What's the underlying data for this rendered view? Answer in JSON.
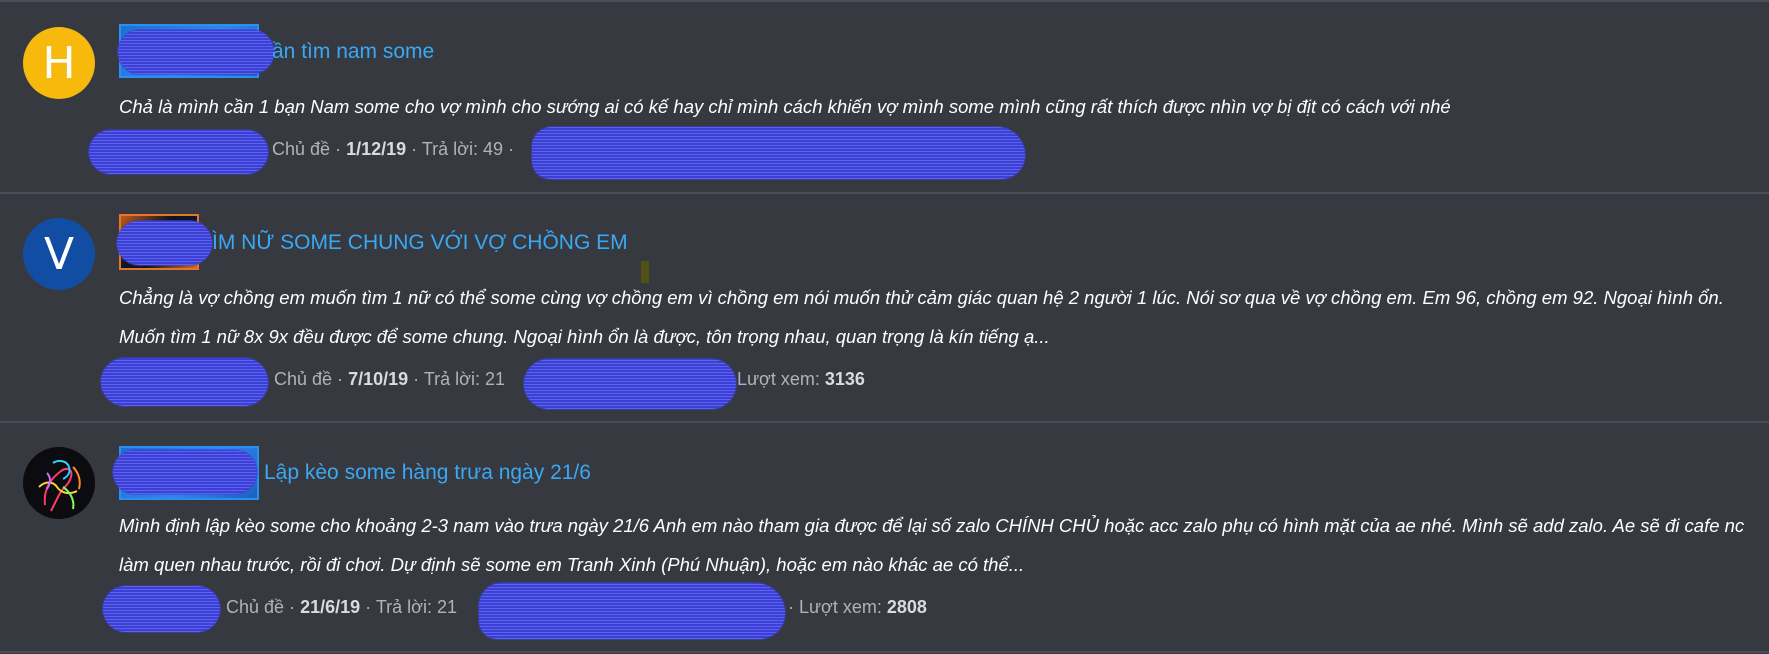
{
  "threads": [
    {
      "avatar_letter": "H",
      "avatar_color": "#f6b90c",
      "title": "ần tìm nam some",
      "snippet": "Chả là mình cần 1 bạn Nam some cho vợ mình cho sướng ai có kế hay chỉ mình cách khiến vợ mình some mình cũng rất thích được nhìn vợ bị địt có cách với nhé",
      "meta": {
        "type_label": "Chủ đề",
        "date": "1/12/19",
        "replies_label": "Trả lời:",
        "replies": "49"
      }
    },
    {
      "avatar_letter": "V",
      "avatar_color": "#114ea3",
      "title": "ÌM NỮ SOME CHUNG VỚI VỢ CHỒNG EM",
      "snippet": "Chẳng là vợ chồng em muốn tìm 1 nữ có thể some cùng vợ chồng em vì chồng em nói muốn thử cảm giác quan hệ 2 người 1 lúc. Nói sơ qua về vợ chồng em. Em 96, chồng em 92. Ngoại hình ổn. Muốn tìm 1 nữ 8x 9x đều được để some chung. Ngoại hình ổn là được, tôn trọng nhau, quan trọng là kín tiếng ạ...",
      "meta": {
        "type_label": "Chủ đề",
        "date": "7/10/19",
        "replies_label": "Trả lời:",
        "replies": "21",
        "views_label": "Lượt xem:",
        "views": "3136"
      }
    },
    {
      "avatar_letter": "",
      "avatar_color": "#0b0b10",
      "title": "Lập kèo some hàng trưa ngày 21/6",
      "snippet": "Mình định lập kèo some cho khoảng 2-3 nam vào trưa ngày 21/6 Anh em nào tham gia được để lại số zalo CHÍNH CHỦ hoặc acc zalo phụ có hình mặt của ae nhé. Mình sẽ add zalo. Ae sẽ đi cafe nc làm quen nhau trước, rồi đi chơi. Dự định sẽ some em Tranh Xinh (Phú Nhuận), hoặc em nào khác ae có thể...",
      "meta": {
        "type_label": "Chủ đề",
        "date": "21/6/19",
        "replies_label": "Trả lời:",
        "replies": "21",
        "views_label": "Lượt xem:",
        "views": "2808"
      }
    }
  ],
  "colors": {
    "background": "#363940",
    "link": "#3aa8f3",
    "redaction": "#3b3fd6",
    "divider": "#4a4d55"
  }
}
